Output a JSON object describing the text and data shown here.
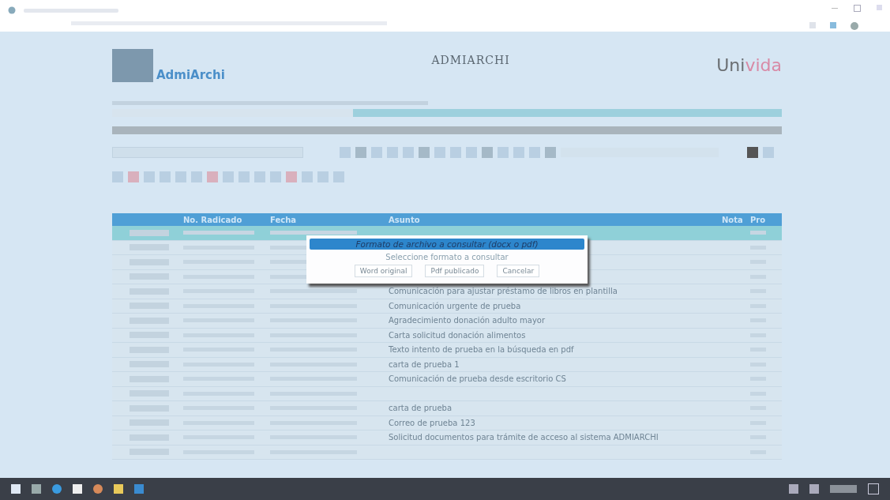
{
  "header": {
    "logo_text": "AdmiArchi",
    "title": "ADMIARCHI",
    "brand": {
      "part_1": "Uni",
      "part_2": "vida"
    }
  },
  "table": {
    "columns": [
      "No. Radicado",
      "Fecha",
      "Asunto",
      "Nota",
      "Pro"
    ],
    "rows": [
      {
        "subject": "",
        "selected": true
      },
      {
        "subject": "",
        "selected": false
      },
      {
        "subject": "",
        "selected": false
      },
      {
        "subject": "",
        "selected": false
      },
      {
        "subject": "Comunicación para ajustar préstamo de libros en plantilla",
        "selected": false
      },
      {
        "subject": "Comunicación urgente de prueba",
        "selected": false
      },
      {
        "subject": "Agradecimiento donación adulto mayor",
        "selected": false
      },
      {
        "subject": "Carta solicitud donación alimentos",
        "selected": false
      },
      {
        "subject": "Texto intento de prueba en la búsqueda en pdf",
        "selected": false
      },
      {
        "subject": "carta de prueba 1",
        "selected": false
      },
      {
        "subject": "Comunicación de prueba desde escritorio CS",
        "selected": false
      },
      {
        "subject": "",
        "selected": false
      },
      {
        "subject": "carta de prueba",
        "selected": false
      },
      {
        "subject": "Correo de prueba 123",
        "selected": false
      },
      {
        "subject": "Solicitud documentos para trámite de acceso al sistema ADMIARCHI",
        "selected": false
      },
      {
        "subject": "",
        "selected": false
      }
    ]
  },
  "dialog": {
    "title": "Formato de archivo a consultar (docx o pdf)",
    "message": "Seleccione formato a consultar",
    "buttons": [
      "Word original",
      "Pdf publicado",
      "Cancelar"
    ]
  }
}
